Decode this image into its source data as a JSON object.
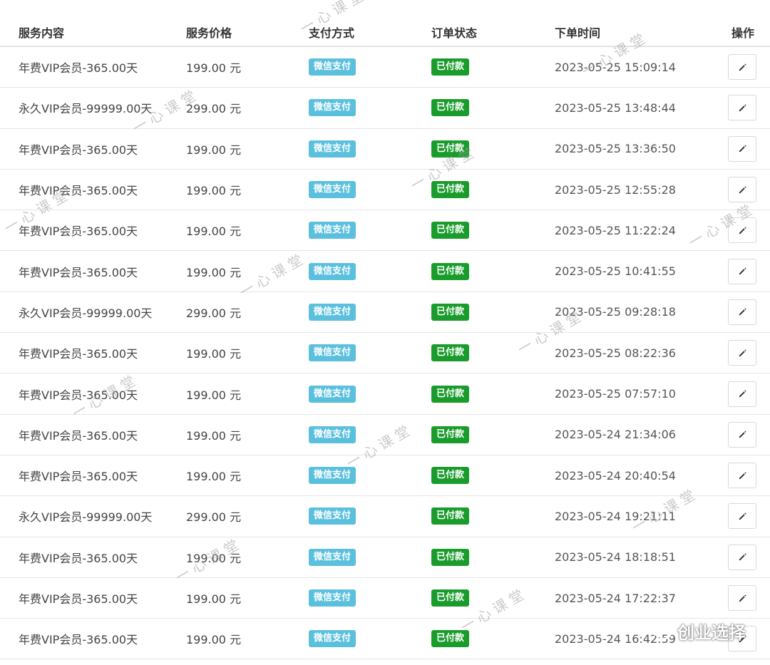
{
  "table": {
    "headers": {
      "service": "服务内容",
      "price": "服务价格",
      "payment": "支付方式",
      "status": "订单状态",
      "time": "下单时间",
      "action": "操作"
    },
    "rows": [
      {
        "service": "年费VIP会员-365.00天",
        "price": "199.00 元",
        "payment": "微信支付",
        "status": "已付款",
        "time": "2023-05-25 15:09:14"
      },
      {
        "service": "永久VIP会员-99999.00天",
        "price": "299.00 元",
        "payment": "微信支付",
        "status": "已付款",
        "time": "2023-05-25 13:48:44"
      },
      {
        "service": "年费VIP会员-365.00天",
        "price": "199.00 元",
        "payment": "微信支付",
        "status": "已付款",
        "time": "2023-05-25 13:36:50"
      },
      {
        "service": "年费VIP会员-365.00天",
        "price": "199.00 元",
        "payment": "微信支付",
        "status": "已付款",
        "time": "2023-05-25 12:55:28"
      },
      {
        "service": "年费VIP会员-365.00天",
        "price": "199.00 元",
        "payment": "微信支付",
        "status": "已付款",
        "time": "2023-05-25 11:22:24"
      },
      {
        "service": "年费VIP会员-365.00天",
        "price": "199.00 元",
        "payment": "微信支付",
        "status": "已付款",
        "time": "2023-05-25 10:41:55"
      },
      {
        "service": "永久VIP会员-99999.00天",
        "price": "299.00 元",
        "payment": "微信支付",
        "status": "已付款",
        "time": "2023-05-25 09:28:18"
      },
      {
        "service": "年费VIP会员-365.00天",
        "price": "199.00 元",
        "payment": "微信支付",
        "status": "已付款",
        "time": "2023-05-25 08:22:36"
      },
      {
        "service": "年费VIP会员-365.00天",
        "price": "199.00 元",
        "payment": "微信支付",
        "status": "已付款",
        "time": "2023-05-25 07:57:10"
      },
      {
        "service": "年费VIP会员-365.00天",
        "price": "199.00 元",
        "payment": "微信支付",
        "status": "已付款",
        "time": "2023-05-24 21:34:06"
      },
      {
        "service": "年费VIP会员-365.00天",
        "price": "199.00 元",
        "payment": "微信支付",
        "status": "已付款",
        "time": "2023-05-24 20:40:54"
      },
      {
        "service": "永久VIP会员-99999.00天",
        "price": "299.00 元",
        "payment": "微信支付",
        "status": "已付款",
        "time": "2023-05-24 19:21:11"
      },
      {
        "service": "年费VIP会员-365.00天",
        "price": "199.00 元",
        "payment": "微信支付",
        "status": "已付款",
        "time": "2023-05-24 18:18:51"
      },
      {
        "service": "年费VIP会员-365.00天",
        "price": "199.00 元",
        "payment": "微信支付",
        "status": "已付款",
        "time": "2023-05-24 17:22:37"
      },
      {
        "service": "年费VIP会员-365.00天",
        "price": "199.00 元",
        "payment": "微信支付",
        "status": "已付款",
        "time": "2023-05-24 16:42:59"
      }
    ]
  },
  "icons": {
    "edit": "pencil-icon",
    "brand": "wechat-icon"
  },
  "colors": {
    "payment_label": "#5bc0de",
    "status_label": "#1a9c2c",
    "watermark": "#a0a0a0"
  },
  "watermark_text": "一心课堂",
  "brand": "创业选择"
}
